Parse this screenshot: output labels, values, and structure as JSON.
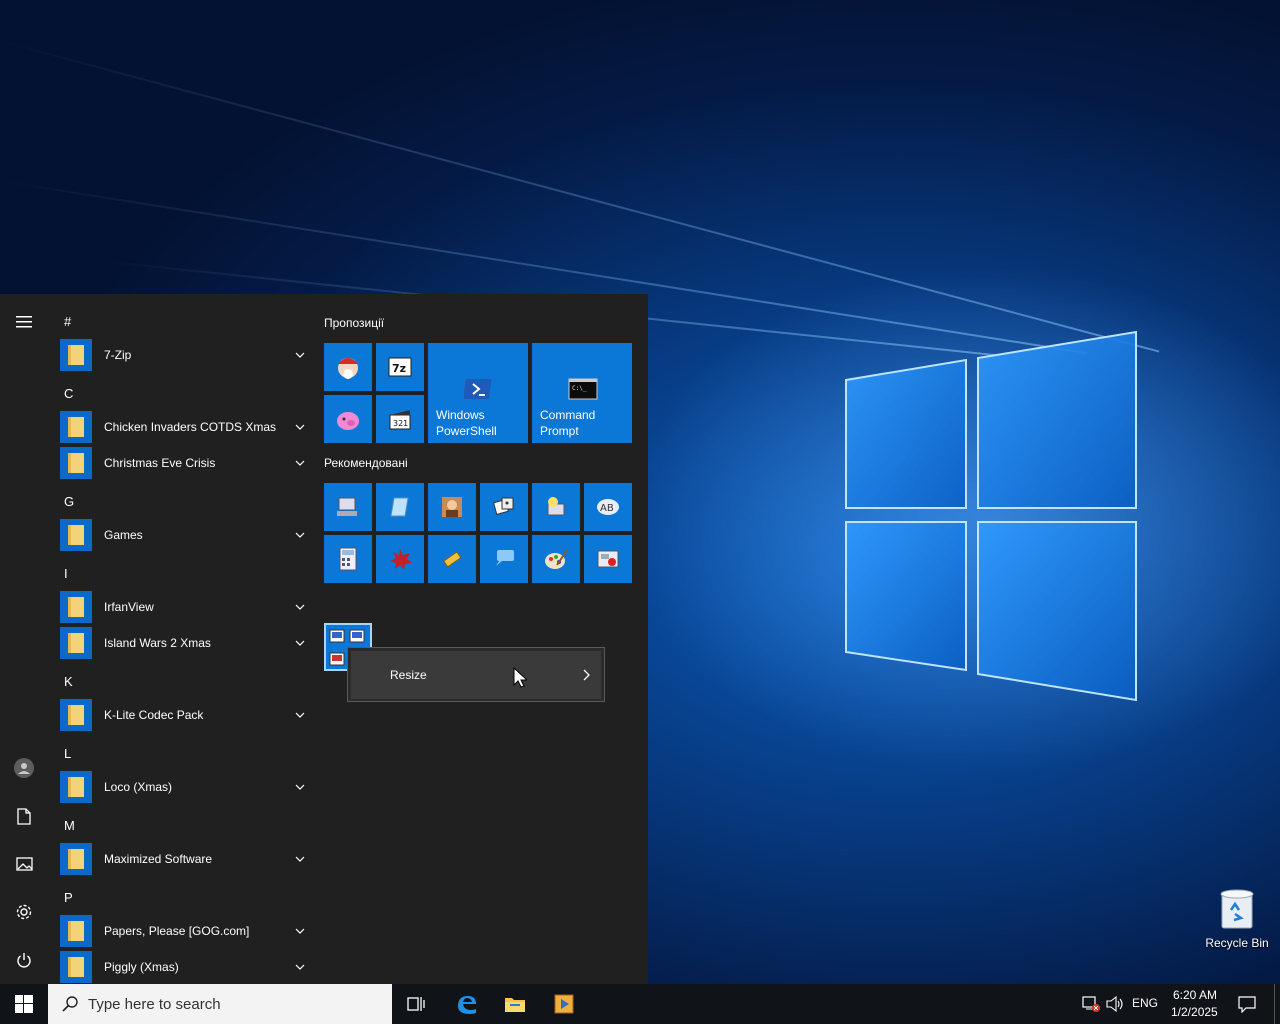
{
  "desktop": {
    "recycle_bin_label": "Recycle Bin"
  },
  "start_menu": {
    "rail": {
      "icons": [
        "hamburger-icon",
        "user-icon",
        "documents-icon",
        "pictures-icon",
        "settings-icon",
        "power-icon"
      ]
    },
    "app_list": {
      "sections": [
        {
          "letter": "#",
          "apps": [
            "7-Zip"
          ]
        },
        {
          "letter": "C",
          "apps": [
            "Chicken Invaders COTDS Xmas",
            "Christmas Eve Crisis"
          ]
        },
        {
          "letter": "G",
          "apps": [
            "Games"
          ]
        },
        {
          "letter": "I",
          "apps": [
            "IrfanView",
            "Island Wars 2 Xmas"
          ]
        },
        {
          "letter": "K",
          "apps": [
            "K-Lite Codec Pack"
          ]
        },
        {
          "letter": "L",
          "apps": [
            "Loco (Xmas)"
          ]
        },
        {
          "letter": "M",
          "apps": [
            "Maximized Software"
          ]
        },
        {
          "letter": "P",
          "apps": [
            "Papers, Please [GOG.com]",
            "Piggly (Xmas)"
          ]
        }
      ]
    },
    "tiles": {
      "group1_title": "Пропозиції",
      "group2_title": "Рекомендовані",
      "powershell_label": "Windows PowerShell",
      "cmd_label": "Command Prompt",
      "small_tile_icons": [
        "santa-icon",
        "7zip-icon",
        "piggy-icon",
        "clapper-icon"
      ],
      "recommended_icons": [
        "network-pc-icon",
        "notepad-icon",
        "portrait-icon",
        "dice-icon",
        "help-icon",
        "ab-icon",
        "calculator-icon",
        "splat-icon",
        "tools-icon",
        "chat-icon",
        "paint-icon",
        "recorder-icon"
      ],
      "selected_tile_icon": "video-files-icon"
    }
  },
  "context_menu": {
    "resize_label": "Resize"
  },
  "taskbar": {
    "search_placeholder": "Type here to search",
    "language": "ENG",
    "time": "6:20 AM",
    "date": "1/2/2025",
    "pinned": [
      "task-view-icon",
      "edge-icon",
      "file-explorer-icon",
      "media-player-icon"
    ]
  }
}
